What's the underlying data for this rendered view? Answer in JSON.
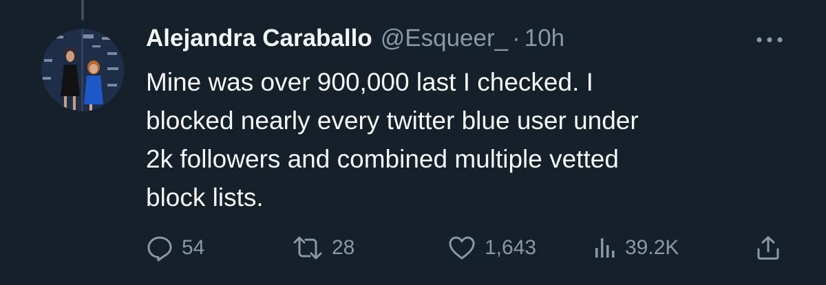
{
  "tweet": {
    "display_name": "Alejandra Caraballo",
    "handle": "@Esqueer_",
    "separator": "·",
    "timestamp": "10h",
    "text": "Mine was over 900,000 last I checked. I blocked nearly every twitter blue user under 2k followers and combined multiple vetted block lists.",
    "text_lines": [
      "Mine was over 900,000 last I checked. I",
      "blocked nearly every twitter blue user under",
      "2k followers and combined multiple vetted",
      "block lists."
    ]
  },
  "actions": {
    "replies": "54",
    "retweets": "28",
    "likes": "1,643",
    "views": "39.2K"
  },
  "icons": {
    "more": "more-horizontal-icon",
    "reply": "reply-icon",
    "retweet": "retweet-icon",
    "like": "heart-icon",
    "views": "views-chart-icon",
    "share": "share-icon"
  },
  "colors": {
    "background": "#15202b",
    "primary_text": "#f7f9f9",
    "secondary_text": "#8b98a5"
  }
}
